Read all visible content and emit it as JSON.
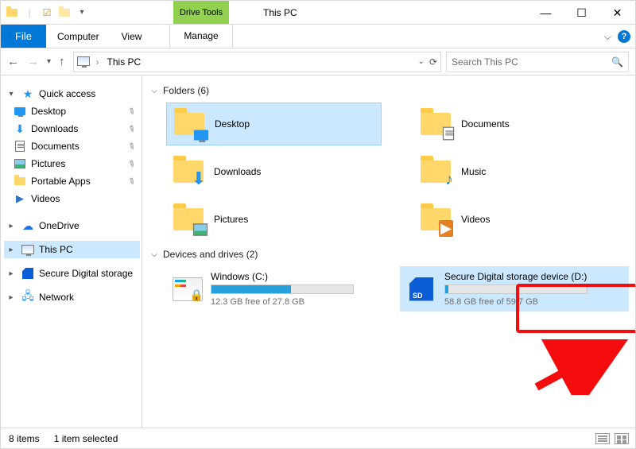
{
  "window": {
    "title": "This PC",
    "qat": {
      "customize_tip": "Customize Quick Access Toolbar"
    },
    "sysbuttons": {
      "min": "—",
      "max": "☐",
      "close": "✕"
    }
  },
  "ribbon": {
    "file": "File",
    "tabs": [
      "Computer",
      "View"
    ],
    "context_group": "Drive Tools",
    "context_tab": "Manage",
    "expand_tip": "Expand the Ribbon",
    "help_tip": "Help"
  },
  "address": {
    "back_tip": "Back",
    "forward_tip": "Forward",
    "recent_tip": "Recent locations",
    "up_tip": "Up",
    "crumbs": [
      "This PC"
    ],
    "refresh_tip": "Refresh",
    "search_placeholder": "Search This PC"
  },
  "nav": {
    "quick_access": {
      "label": "Quick access",
      "items": [
        {
          "icon": "desktop",
          "label": "Desktop",
          "pinned": true
        },
        {
          "icon": "downloads",
          "label": "Downloads",
          "pinned": true
        },
        {
          "icon": "documents",
          "label": "Documents",
          "pinned": true
        },
        {
          "icon": "pictures",
          "label": "Pictures",
          "pinned": true
        },
        {
          "icon": "folder",
          "label": "Portable Apps",
          "pinned": true
        },
        {
          "icon": "videos",
          "label": "Videos",
          "pinned": false
        }
      ]
    },
    "onedrive": {
      "label": "OneDrive"
    },
    "this_pc": {
      "label": "This PC",
      "selected": true
    },
    "sd": {
      "label": "Secure Digital storage"
    },
    "network": {
      "label": "Network"
    }
  },
  "content": {
    "folders_header": "Folders (6)",
    "folders": [
      {
        "key": "desktop",
        "label": "Desktop",
        "selected": true,
        "overlay": "monitor"
      },
      {
        "key": "documents",
        "label": "Documents",
        "selected": false,
        "overlay": "doc"
      },
      {
        "key": "downloads",
        "label": "Downloads",
        "selected": false,
        "overlay": "down"
      },
      {
        "key": "music",
        "label": "Music",
        "selected": false,
        "overlay": "music"
      },
      {
        "key": "pictures",
        "label": "Pictures",
        "selected": false,
        "overlay": "pic"
      },
      {
        "key": "videos",
        "label": "Videos",
        "selected": false,
        "overlay": "vid"
      }
    ],
    "drives_header": "Devices and drives (2)",
    "drives": [
      {
        "key": "c",
        "name": "Windows (C:)",
        "free_text": "12.3 GB free of 27.8 GB",
        "fill_pct": 56,
        "selected": false,
        "highlighted": false,
        "icon": "os-locked"
      },
      {
        "key": "d",
        "name": "Secure Digital storage device (D:)",
        "free_text": "58.8 GB free of 59.7 GB",
        "fill_pct": 2,
        "selected": true,
        "highlighted": true,
        "icon": "sd"
      }
    ]
  },
  "status": {
    "items": "8 items",
    "selected": "1 item selected"
  }
}
